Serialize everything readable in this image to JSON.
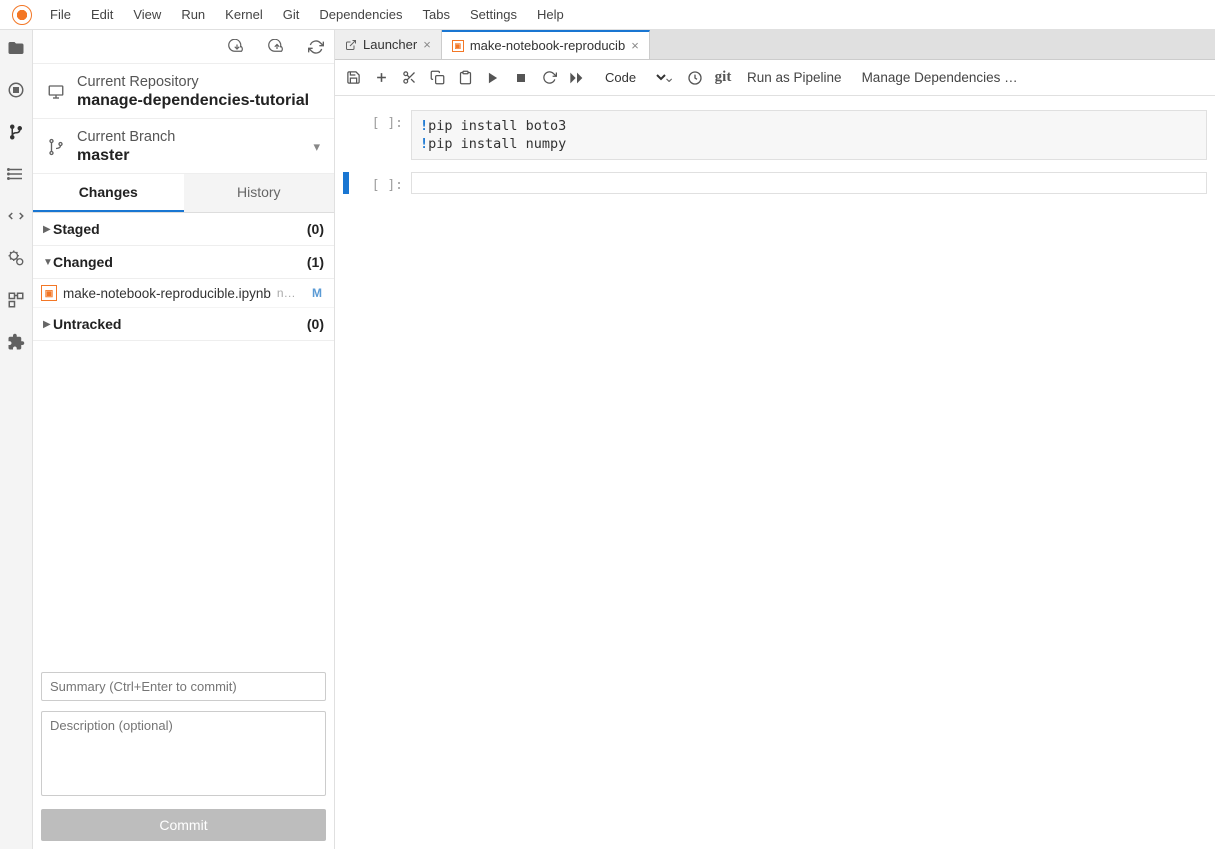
{
  "menu": [
    "File",
    "Edit",
    "View",
    "Run",
    "Kernel",
    "Git",
    "Dependencies",
    "Tabs",
    "Settings",
    "Help"
  ],
  "git": {
    "repo_label": "Current Repository",
    "repo_name": "manage-dependencies-tutorial",
    "branch_label": "Current Branch",
    "branch_name": "master",
    "tab_changes": "Changes",
    "tab_history": "History",
    "sections": {
      "staged": {
        "label": "Staged",
        "count": "(0)"
      },
      "changed": {
        "label": "Changed",
        "count": "(1)"
      },
      "untracked": {
        "label": "Untracked",
        "count": "(0)"
      }
    },
    "changed_file": {
      "name": "make-notebook-reproducible.ipynb",
      "path": "noteb…",
      "status": "M"
    },
    "summary_placeholder": "Summary (Ctrl+Enter to commit)",
    "description_placeholder": "Description (optional)",
    "commit_btn": "Commit"
  },
  "tabs": {
    "launcher": "Launcher",
    "notebook": "make-notebook-reproducib"
  },
  "toolbar": {
    "cell_type": "Code",
    "git_label": "git",
    "run_pipeline": "Run as Pipeline",
    "manage_deps": "Manage Dependencies …"
  },
  "cells": {
    "prompt": "[ ]:",
    "c1_line1_cmd": "pip install boto3",
    "c1_line2_cmd": "pip install numpy"
  }
}
